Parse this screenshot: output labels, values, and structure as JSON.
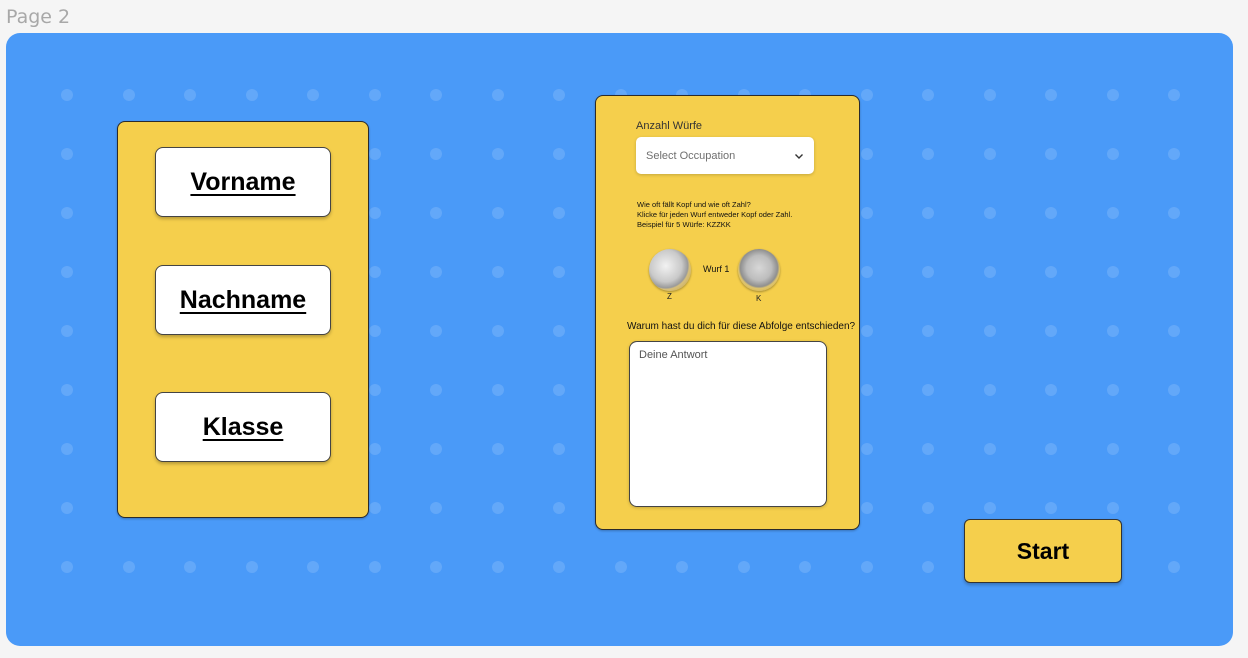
{
  "page_label": "Page 2",
  "left_card": {
    "buttons": [
      {
        "label": "Vorname"
      },
      {
        "label": "Nachname"
      },
      {
        "label": "Klasse"
      }
    ]
  },
  "right_card": {
    "count_label": "Anzahl Würfe",
    "select": {
      "value": "Select Occupation"
    },
    "instructions": [
      "Wie oft fällt Kopf und wie oft Zahl?",
      "Klicke für jeden Wurf entweder Kopf oder Zahl.",
      "Beispiel für 5 Würfe: KZZKK"
    ],
    "coin_z_label": "Z",
    "coin_k_label": "K",
    "throw_label": "Wurf 1",
    "question": "Warum hast du dich für diese Abfolge entschieden?",
    "answer_placeholder": "Deine Antwort"
  },
  "start_label": "Start",
  "colors": {
    "board": "#4a9af8",
    "card": "#f5cf4c",
    "background": "#f5f5f5"
  }
}
